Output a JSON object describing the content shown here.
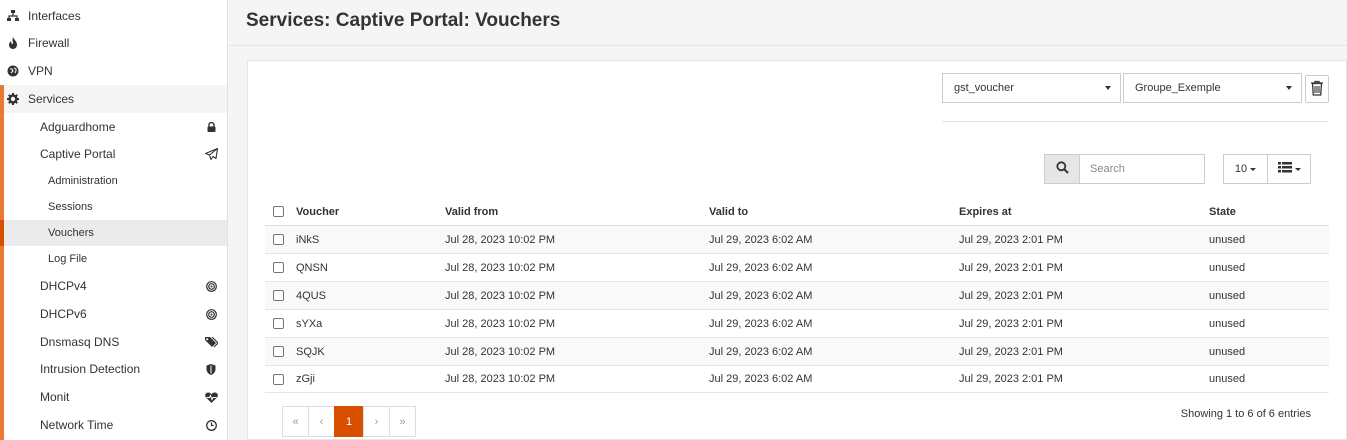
{
  "sidebar": {
    "top_items": [
      {
        "label": "Interfaces",
        "icon": "sitemap-icon"
      },
      {
        "label": "Firewall",
        "icon": "fire-icon"
      },
      {
        "label": "VPN",
        "icon": "globe-icon"
      },
      {
        "label": "Services",
        "icon": "gear-icon"
      }
    ],
    "services": [
      {
        "label": "Adguardhome",
        "icon": "lock-icon"
      },
      {
        "label": "Captive Portal",
        "icon": "paper-plane-icon"
      },
      {
        "label": "DHCPv4",
        "icon": "bullseye-icon"
      },
      {
        "label": "DHCPv6",
        "icon": "bullseye-icon"
      },
      {
        "label": "Dnsmasq DNS",
        "icon": "tags-icon"
      },
      {
        "label": "Intrusion Detection",
        "icon": "shield-icon"
      },
      {
        "label": "Monit",
        "icon": "heartbeat-icon"
      },
      {
        "label": "Network Time",
        "icon": "clock-icon"
      }
    ],
    "captive_portal": [
      "Administration",
      "Sessions",
      "Vouchers",
      "Log File"
    ]
  },
  "page": {
    "title": "Services: Captive Portal: Vouchers"
  },
  "filters": {
    "provider": "gst_voucher",
    "group": "Groupe_Exemple"
  },
  "search": {
    "placeholder": "Search"
  },
  "page_size": "10",
  "table": {
    "columns": [
      "Voucher",
      "Valid from",
      "Valid to",
      "Expires at",
      "State"
    ],
    "rows": [
      [
        "iNkS",
        "Jul 28, 2023 10:02 PM",
        "Jul 29, 2023 6:02 AM",
        "Jul 29, 2023 2:01 PM",
        "unused"
      ],
      [
        "QNSN",
        "Jul 28, 2023 10:02 PM",
        "Jul 29, 2023 6:02 AM",
        "Jul 29, 2023 2:01 PM",
        "unused"
      ],
      [
        "4QUS",
        "Jul 28, 2023 10:02 PM",
        "Jul 29, 2023 6:02 AM",
        "Jul 29, 2023 2:01 PM",
        "unused"
      ],
      [
        "sYXa",
        "Jul 28, 2023 10:02 PM",
        "Jul 29, 2023 6:02 AM",
        "Jul 29, 2023 2:01 PM",
        "unused"
      ],
      [
        "SQJK",
        "Jul 28, 2023 10:02 PM",
        "Jul 29, 2023 6:02 AM",
        "Jul 29, 2023 2:01 PM",
        "unused"
      ],
      [
        "zGji",
        "Jul 28, 2023 10:02 PM",
        "Jul 29, 2023 6:02 AM",
        "Jul 29, 2023 2:01 PM",
        "unused"
      ]
    ]
  },
  "pagination": {
    "first": "«",
    "prev": "‹",
    "current": "1",
    "next": "›",
    "last": "»"
  },
  "footer": {
    "showing": "Showing 1 to 6 of 6 entries"
  },
  "colors": {
    "accent": "#d94f00",
    "services_bar": "#e87a36"
  }
}
